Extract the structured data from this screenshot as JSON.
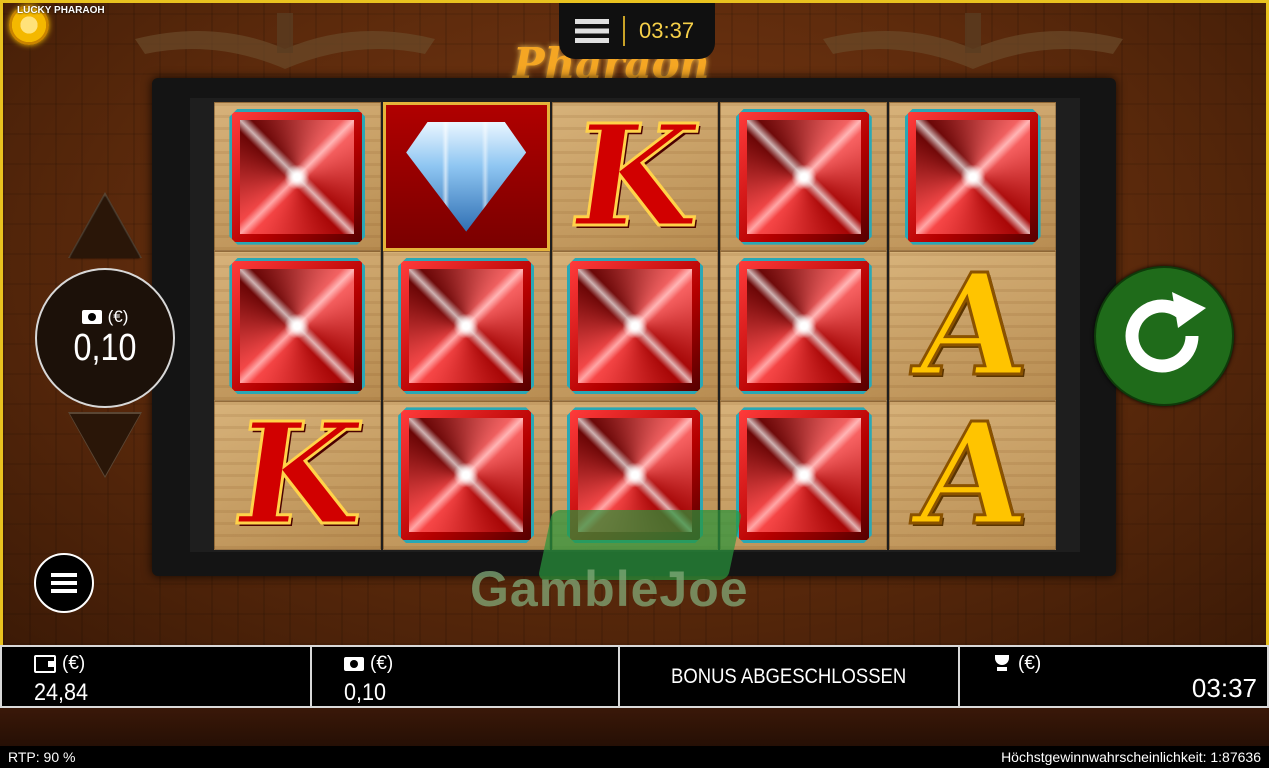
{
  "header": {
    "game_logo_text": "LUCKY PHARAOH",
    "game_title": "Pharaoh",
    "clock": "03:37"
  },
  "reels": [
    [
      "red-gem",
      "red-gem",
      "king-k"
    ],
    [
      "diamond",
      "red-gem",
      "red-gem"
    ],
    [
      "king-k",
      "red-gem",
      "red-gem"
    ],
    [
      "red-gem",
      "red-gem",
      "red-gem"
    ],
    [
      "red-gem",
      "ace-a",
      "ace-a"
    ]
  ],
  "bet_control": {
    "currency_label": "(€)",
    "value": "0,10"
  },
  "watermark": "GambleJoe",
  "status_bar": {
    "balance": {
      "currency_label": "(€)",
      "value": "24,84"
    },
    "bet": {
      "currency_label": "(€)",
      "value": "0,10"
    },
    "message": "BONUS ABGESCHLOSSEN",
    "win": {
      "currency_label": "(€)",
      "time": "03:37"
    }
  },
  "footer": {
    "rtp": "RTP: 90 %",
    "max_win_probability": "Höchstgewinnwahrscheinlichkeit: 1:87636"
  },
  "colors": {
    "frame_gold": "#e9c21f",
    "spin_green": "#1f6b1a",
    "clock_gold": "#f6d049"
  }
}
